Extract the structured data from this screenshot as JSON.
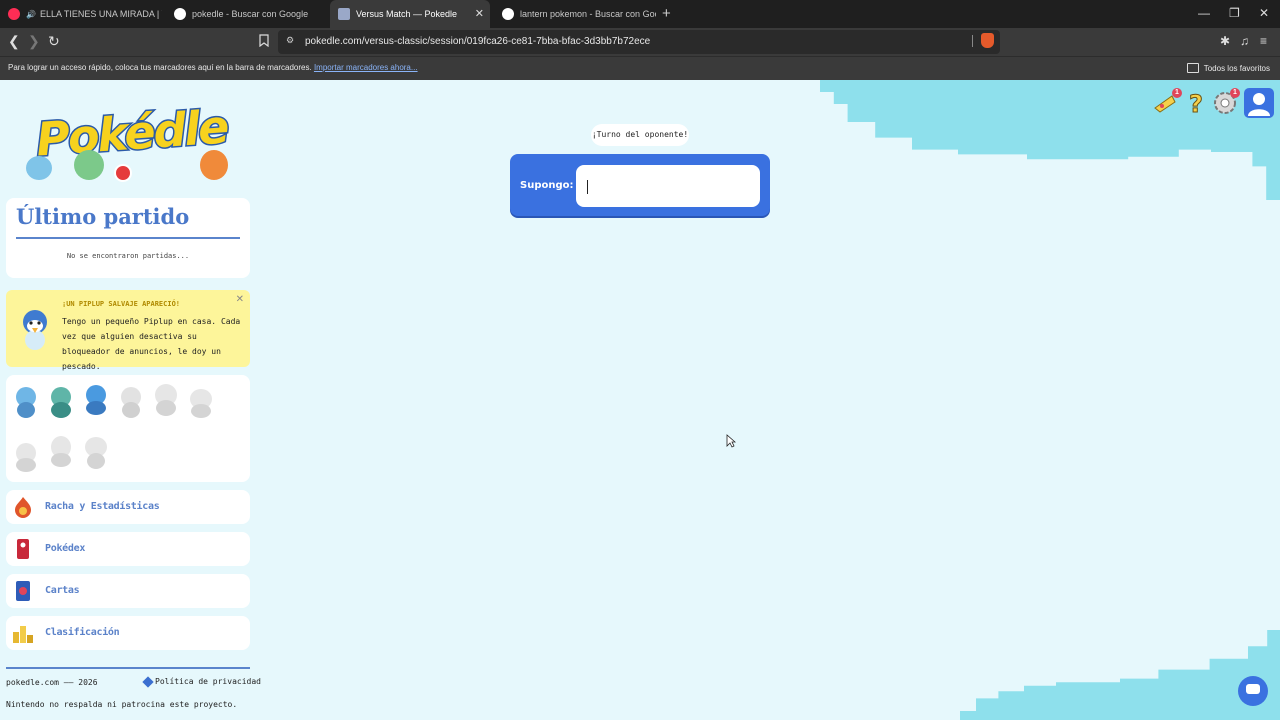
{
  "browser": {
    "tabs": [
      {
        "label": "ELLA TIENES UNA MIRADA | YouT",
        "active": false,
        "icon": "youtube-icon"
      },
      {
        "label": "pokedle - Buscar con Google",
        "active": false,
        "icon": "google-icon"
      },
      {
        "label": "Versus Match — Pokedle",
        "active": true,
        "icon": "pokedle-icon"
      },
      {
        "label": "lantern pokemon - Buscar con Goog",
        "active": false,
        "icon": "google-icon"
      }
    ],
    "url": "pokedle.com/versus-classic/session/019fca26-ce81-7bba-bfac-3d3bb7b72ece",
    "bookmarks_hint": "Para lograr un acceso rápido, coloca tus marcadores aquí en la barra de marcadores.",
    "bookmarks_import": "Importar marcadores ahora...",
    "all_favorites": "Todos los favoritos",
    "shield_count": "2"
  },
  "sidebar": {
    "last_match_title": "Último partido",
    "last_match_empty": "No se encontraron partidas...",
    "ad": {
      "title": "¡UN PIPLUP SALVAJE APARECIÓ!",
      "body": "Tengo un pequeño Piplup en casa. Cada vez que alguien desactiva su bloqueador de anuncios, le doy un pescado."
    },
    "menu": [
      {
        "label": "Racha y Estadísticas",
        "icon": "fire-icon"
      },
      {
        "label": "Pokédex",
        "icon": "pokedex-icon"
      },
      {
        "label": "Cartas",
        "icon": "cards-icon"
      },
      {
        "label": "Clasificación",
        "icon": "podium-icon"
      }
    ],
    "footer": {
      "site": "pokedle.com —— 2026",
      "privacy": "Política de privacidad",
      "disclaimer": "Nintendo no respalda ni patrocina este proyecto."
    }
  },
  "header_icons": {
    "notifications_badge": "1",
    "settings_badge": "1"
  },
  "game": {
    "turn_text": "¡Turno del oponente!",
    "guess_label": "Supongo:",
    "guess_value": ""
  },
  "colors": {
    "accent_blue": "#3a71e0",
    "page_bg": "#e6f8fc",
    "wave": "#8ee0ec",
    "ad_bg": "#fdf59a"
  }
}
